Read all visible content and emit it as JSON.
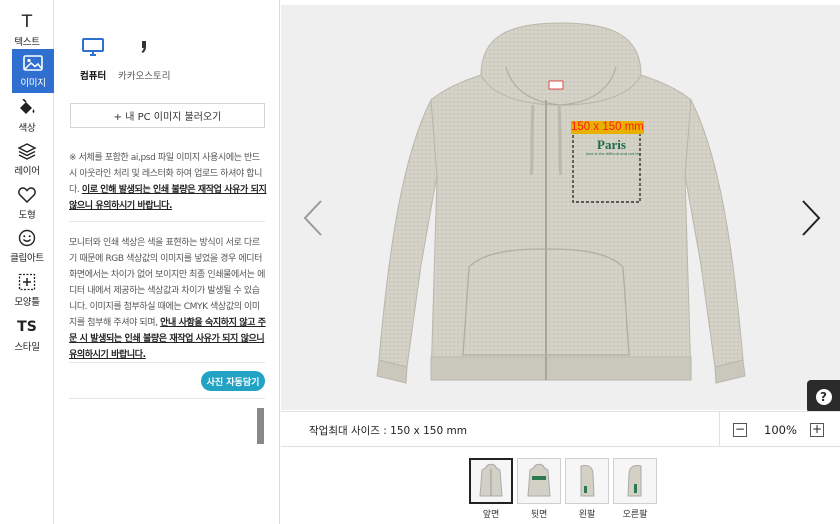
{
  "toolbar": {
    "items": [
      {
        "id": "text",
        "label": "텍스트",
        "icon": "text-icon"
      },
      {
        "id": "image",
        "label": "이미지",
        "icon": "image-icon",
        "active": true
      },
      {
        "id": "color",
        "label": "색상",
        "icon": "paint-bucket-icon"
      },
      {
        "id": "layer",
        "label": "레이어",
        "icon": "layers-icon"
      },
      {
        "id": "shape",
        "label": "도형",
        "icon": "heart-icon"
      },
      {
        "id": "clipart",
        "label": "클립아트",
        "icon": "smiley-icon"
      },
      {
        "id": "pattern",
        "label": "모양틀",
        "icon": "frame-plus-icon"
      },
      {
        "id": "style",
        "label": "스타일",
        "icon": "ts-icon"
      }
    ],
    "text_glyph": "T",
    "style_glyph": "TS"
  },
  "panel": {
    "sources": [
      {
        "label": "컴퓨터",
        "icon": "monitor-icon",
        "active": true
      },
      {
        "label": "카카오스토리",
        "icon": "kakaostory-icon",
        "active": false
      }
    ],
    "load_button": "+ 내 PC 이미지 불러오기",
    "notice1_text": "※ 서체를 포함한 ai,psd 파일 이미지 사용시에는 반드시 아웃라인 처리 및 레스터화 하여 업로드 하셔야 합니다.",
    "notice1_emphasis": "이로 인해 발생되는 인쇄 불량은 재작업 사유가 되지않으니 유의하시기 바랍니다.",
    "notice2_text": "모니터와 인쇄 색상은 색을 표현하는 방식이 서로 다르기 때문에 RGB 색상값의 이미지를 넣었을 경우 에디터 화면에서는 차이가 없어 보이지만 최종 인쇄물에서는 에디터 내에서 제공하는 색상값과 차이가 발생될 수 있습니다. 이미지를 첨부하실 때에는 CMYK 색상값의 이미지를 첨부해 주셔야 되며,",
    "notice2_emphasis": "안내 사항을 숙지하지 않고 주문 시 발생되는 인쇄 불량은 재작업 사유가 되지 않으니 유의하시기 바랍니다.",
    "auto_button": "사진 자동담기"
  },
  "canvas": {
    "print_area_label": "150 x 150 mm",
    "design_title": "Paris",
    "design_subtitle": "love is the difficult and not the",
    "garment_color": "#d3d1c6",
    "label_bg": "#e8b000",
    "label_text_color": "#ff1a1a",
    "design_color": "#1e6b4a"
  },
  "status": {
    "size_text": "작업최대 사이즈 : 150 x 150 mm",
    "zoom": "100%",
    "zoom_minus": "−",
    "zoom_plus": "+"
  },
  "views": [
    {
      "label": "앞면",
      "selected": true
    },
    {
      "label": "뒷면",
      "selected": false
    },
    {
      "label": "왼팔",
      "selected": false
    },
    {
      "label": "오른팔",
      "selected": false
    }
  ],
  "help_label": "?"
}
